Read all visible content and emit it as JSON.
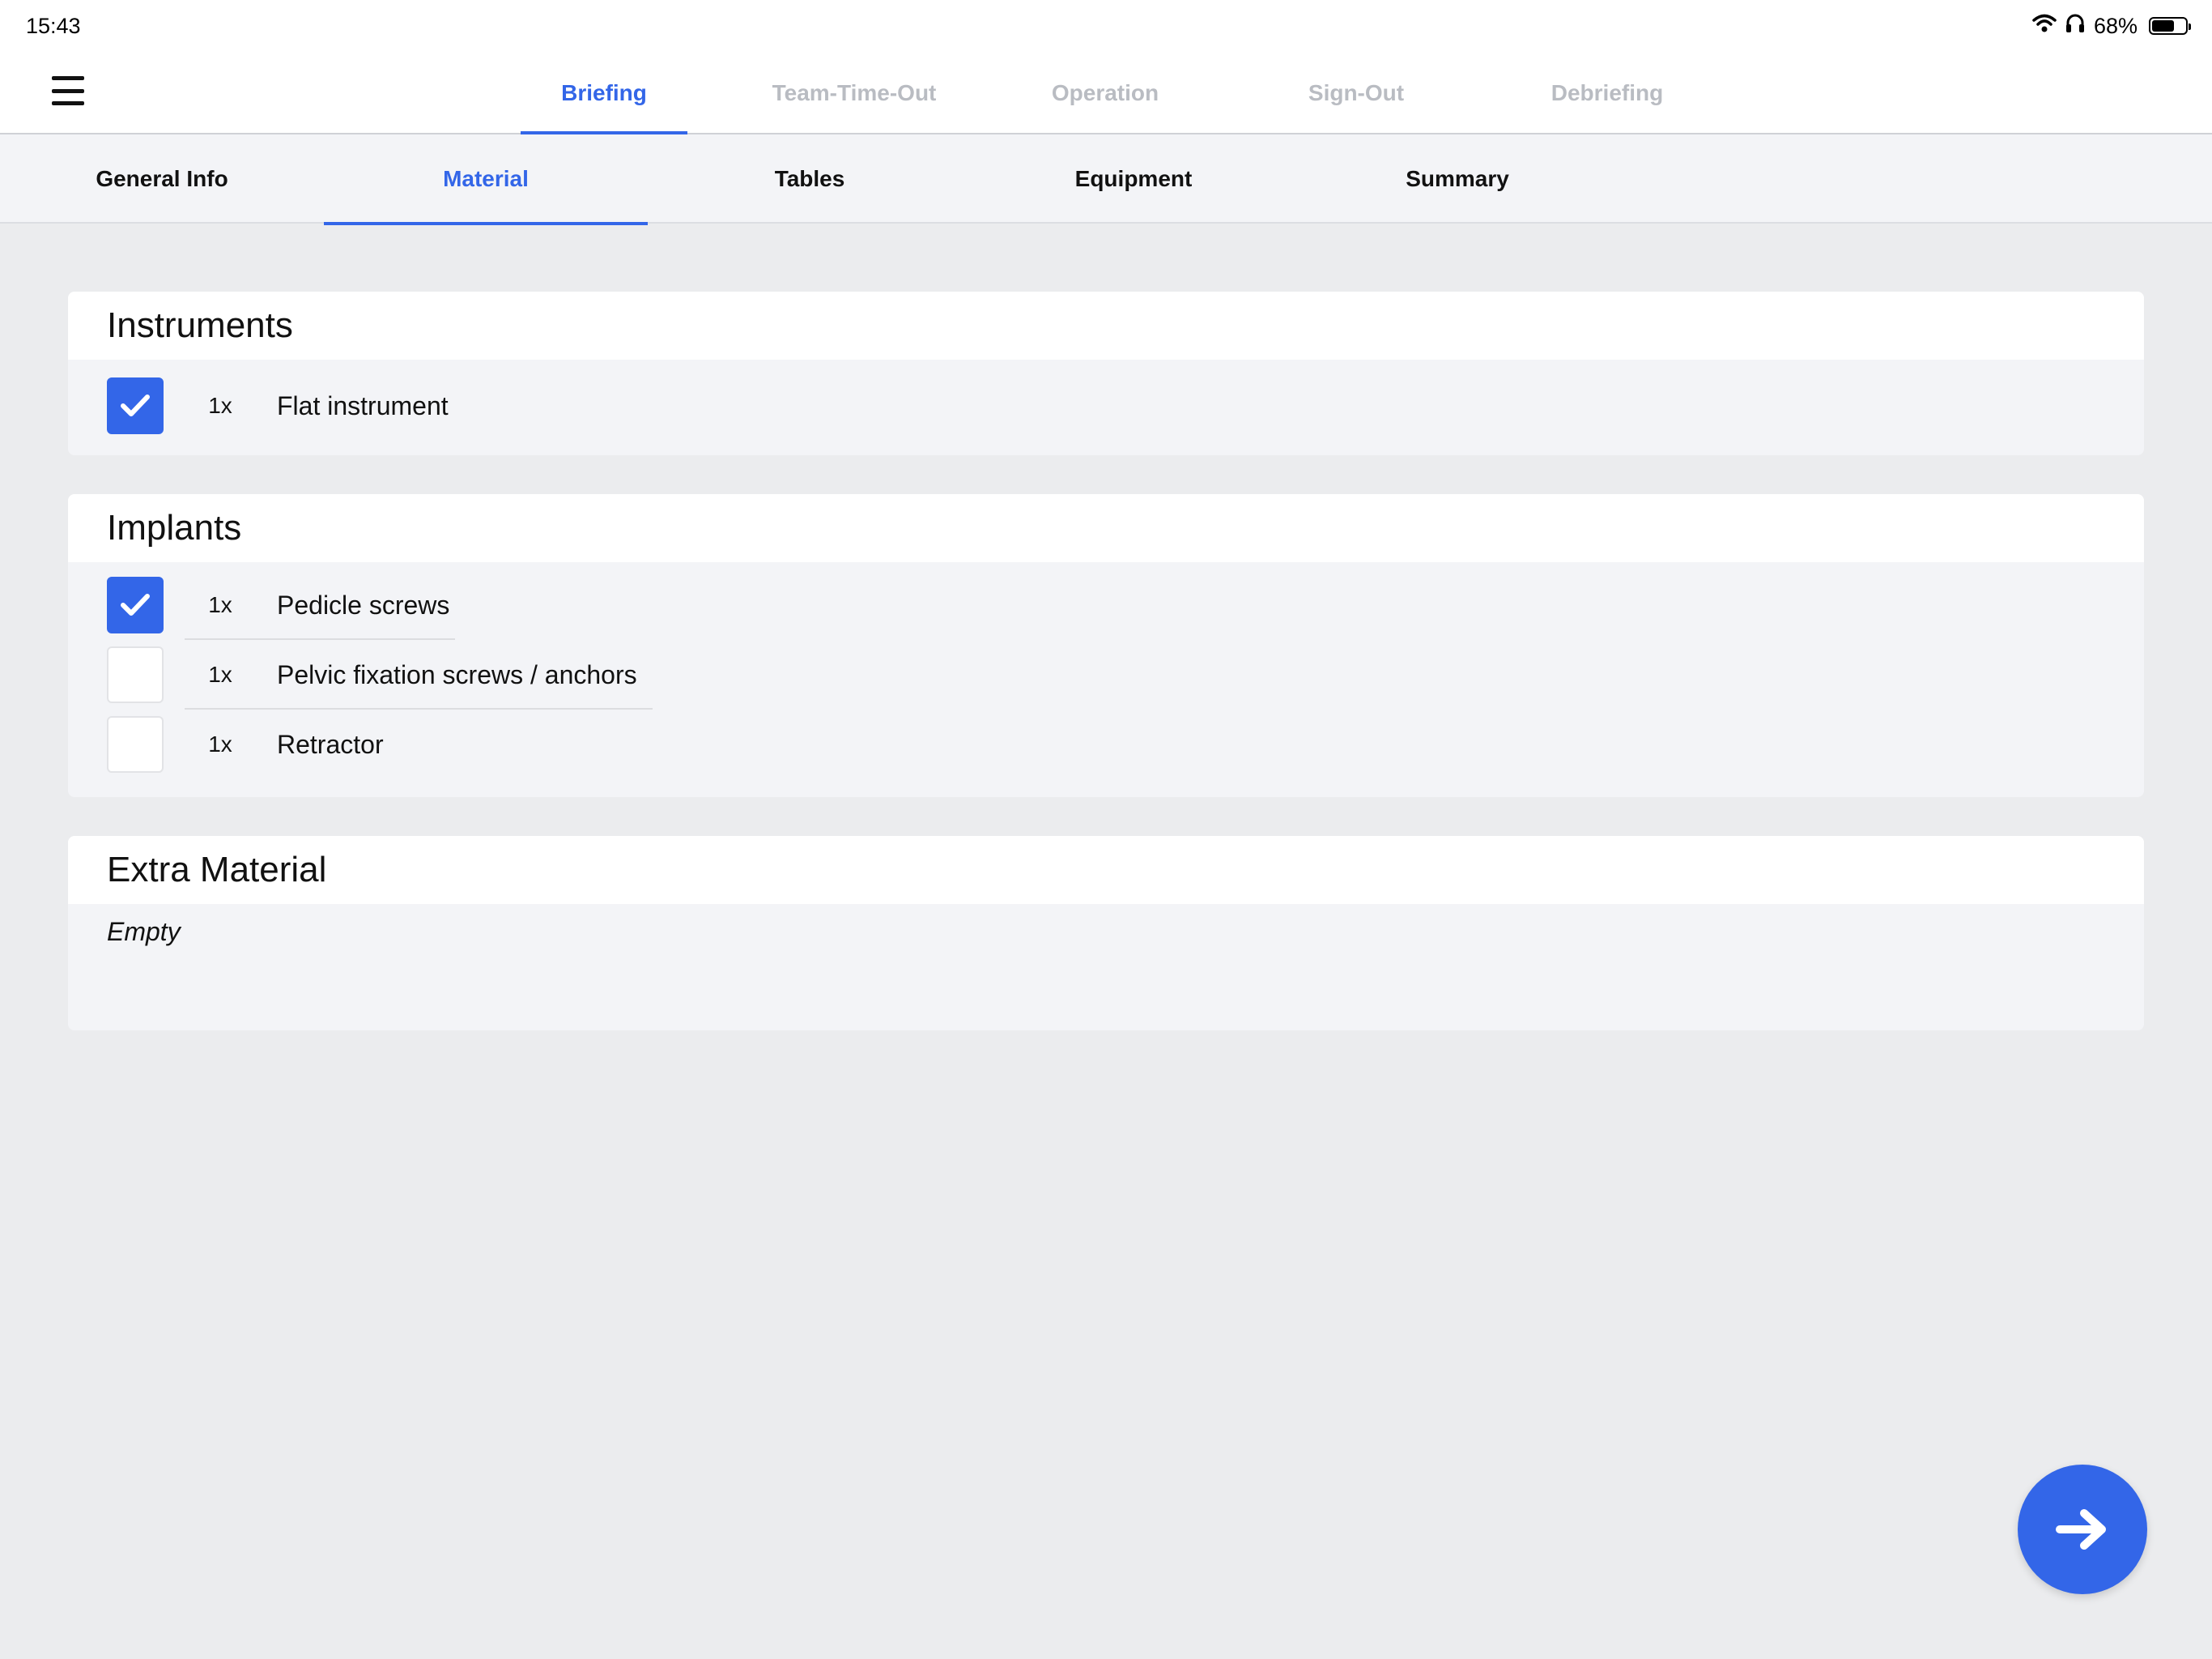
{
  "status_bar": {
    "time": "15:43",
    "battery_text": "68%",
    "battery_level": 0.68,
    "icons": [
      "wifi-icon",
      "headphones-icon",
      "battery-icon"
    ]
  },
  "top_nav": {
    "menu_icon": "hamburger-menu-icon",
    "tabs": [
      {
        "label": "Briefing",
        "active": true
      },
      {
        "label": "Team-Time-Out",
        "active": false
      },
      {
        "label": "Operation",
        "active": false
      },
      {
        "label": "Sign-Out",
        "active": false
      },
      {
        "label": "Debriefing",
        "active": false
      }
    ]
  },
  "sub_nav": {
    "tabs": [
      {
        "label": "General Info",
        "active": false
      },
      {
        "label": "Material",
        "active": true
      },
      {
        "label": "Tables",
        "active": false
      },
      {
        "label": "Equipment",
        "active": false
      },
      {
        "label": "Summary",
        "active": false
      }
    ]
  },
  "sections": {
    "instruments": {
      "title": "Instruments",
      "items": [
        {
          "qty": "1x",
          "label": "Flat instrument",
          "checked": true
        }
      ]
    },
    "implants": {
      "title": "Implants",
      "items": [
        {
          "qty": "1x",
          "label": "Pedicle screws",
          "checked": true
        },
        {
          "qty": "1x",
          "label": "Pelvic fixation screws / anchors",
          "checked": false
        },
        {
          "qty": "1x",
          "label": "Retractor",
          "checked": false
        }
      ]
    },
    "extra_material": {
      "title": "Extra Material",
      "empty_text": "Empty"
    }
  },
  "fab": {
    "icon": "arrow-right-icon"
  },
  "colors": {
    "accent": "#3366e8",
    "inactive_tab": "#b9bcc2",
    "background": "#ebecee"
  }
}
